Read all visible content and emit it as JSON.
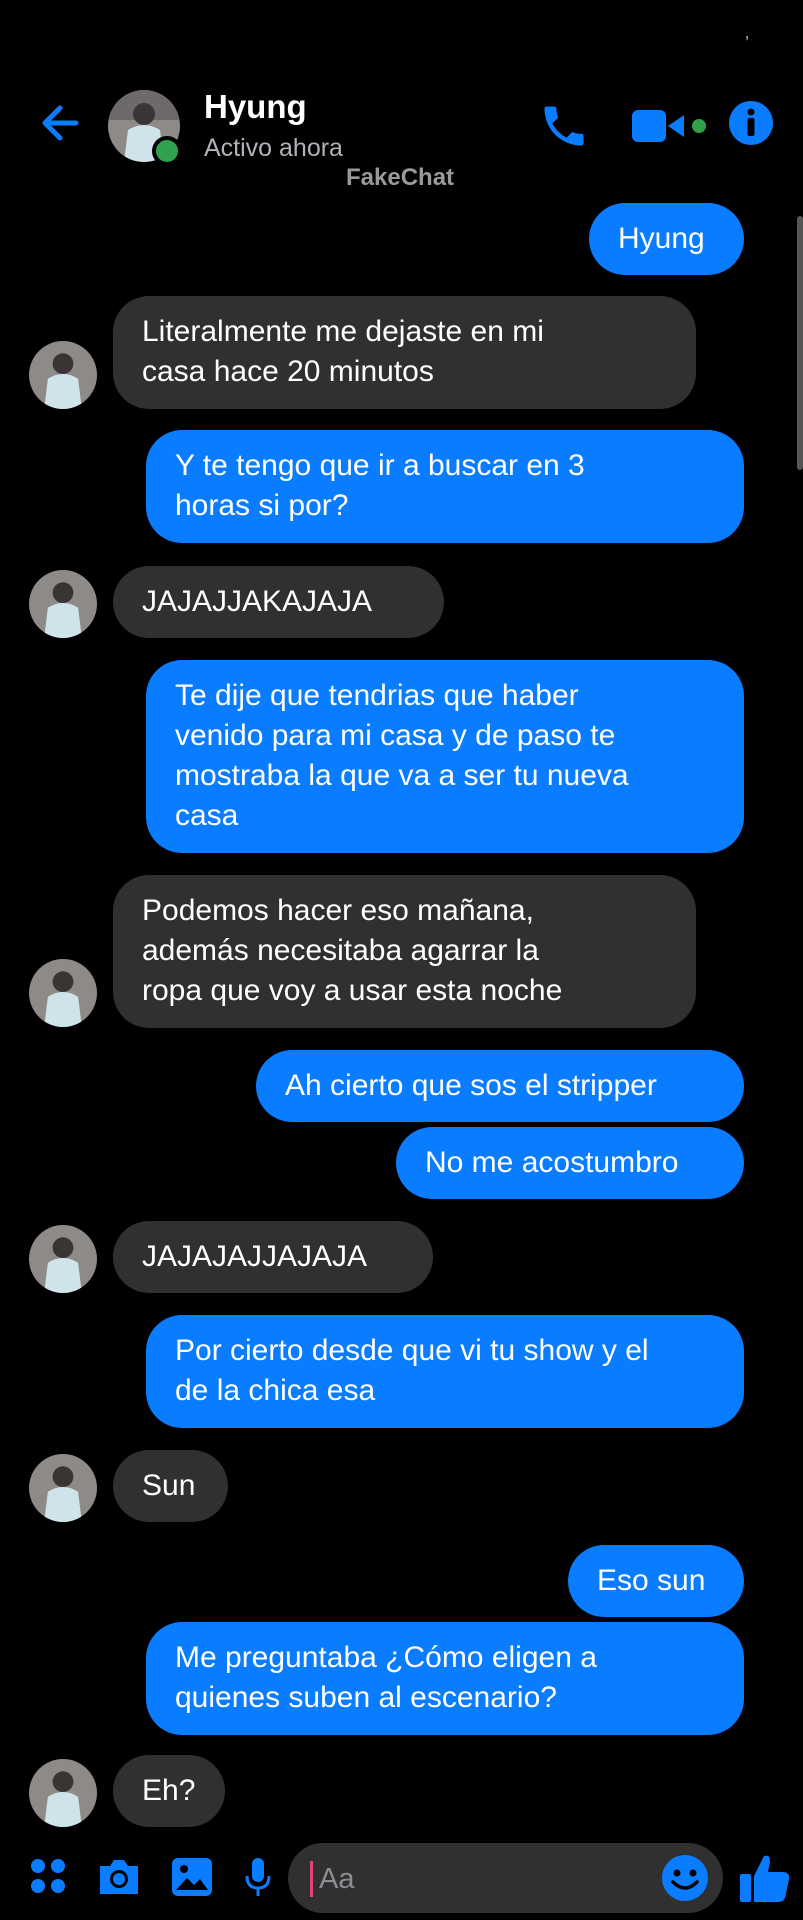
{
  "status_bar": {
    "mark": "‚"
  },
  "header": {
    "title": "Hyung",
    "subtitle": "Activo ahora",
    "watermark": "FakeChat"
  },
  "messages": [
    {
      "from": "me",
      "lines": [
        "Hyung"
      ]
    },
    {
      "from": "contact",
      "lines": [
        "Literalmente me dejaste en mi",
        "casa hace 20 minutos"
      ]
    },
    {
      "from": "me",
      "lines": [
        "Y te tengo que ir a buscar en 3",
        "horas si por?"
      ]
    },
    {
      "from": "contact",
      "lines": [
        "JAJAJJAKAJAJA"
      ]
    },
    {
      "from": "me",
      "lines": [
        "Te dije que tendrias que haber",
        "venido para mi casa y de paso te",
        "mostraba la que va a ser tu nueva",
        "casa"
      ]
    },
    {
      "from": "contact",
      "lines": [
        "Podemos hacer eso mañana,",
        "además necesitaba agarrar la",
        "ropa que voy a usar esta noche"
      ]
    },
    {
      "from": "me",
      "lines": [
        "Ah cierto que sos el stripper"
      ]
    },
    {
      "from": "me",
      "lines": [
        "No me acostumbro"
      ]
    },
    {
      "from": "contact",
      "lines": [
        "JAJAJAJJAJAJA"
      ]
    },
    {
      "from": "me",
      "lines": [
        "Por cierto desde que vi tu show y el",
        "de la chica esa"
      ]
    },
    {
      "from": "contact",
      "lines": [
        "Sun"
      ]
    },
    {
      "from": "me",
      "lines": [
        "Eso sun"
      ]
    },
    {
      "from": "me",
      "lines": [
        "Me preguntaba ¿Cómo eligen a",
        "quienes suben al escenario?"
      ]
    },
    {
      "from": "contact",
      "lines": [
        "Eh?"
      ]
    }
  ],
  "composer": {
    "placeholder": "Aa"
  },
  "colors": {
    "accent": "#0a7cff",
    "received_bubble": "#303030",
    "online": "#31a24c",
    "background": "#000000"
  },
  "icons": [
    "back-arrow-icon",
    "phone-icon",
    "video-camera-icon",
    "info-icon",
    "apps-grid-icon",
    "camera-icon",
    "image-icon",
    "microphone-icon",
    "emoji-icon",
    "thumbs-up-icon"
  ]
}
